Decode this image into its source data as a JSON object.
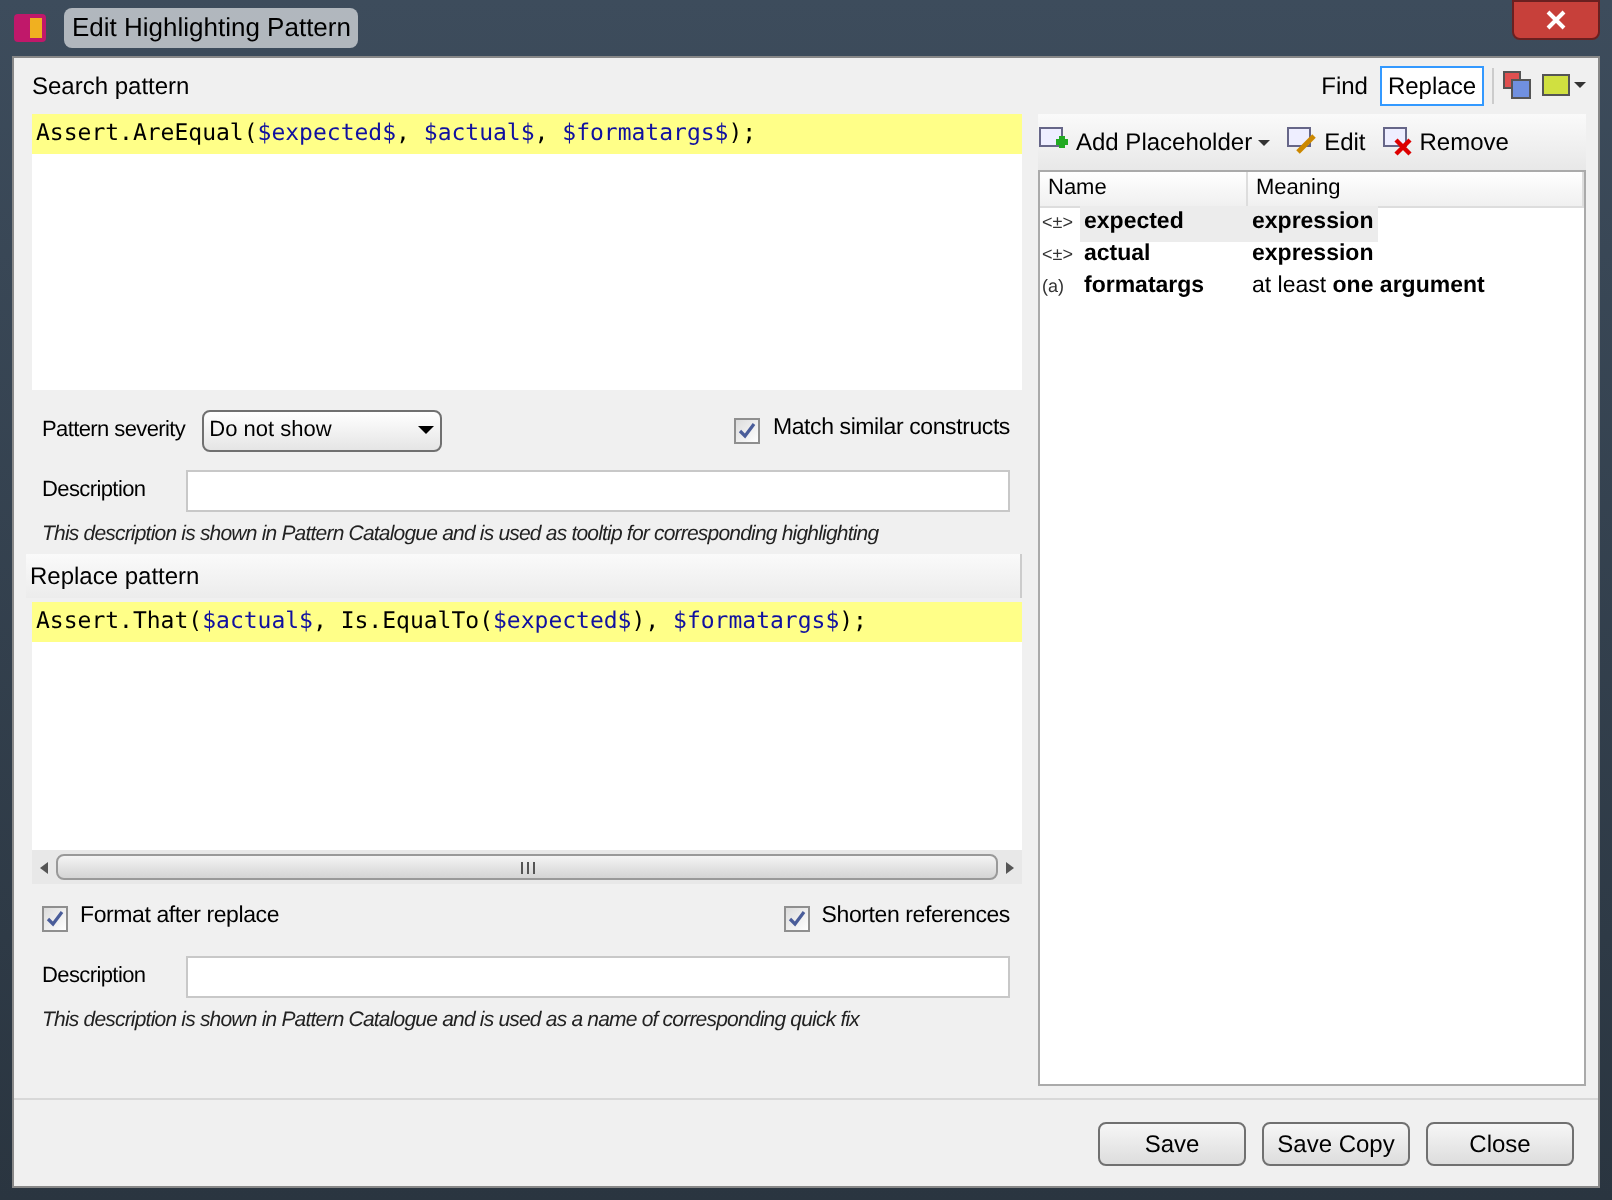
{
  "window": {
    "title": "Edit Highlighting Pattern"
  },
  "search": {
    "label": "Search pattern",
    "code": [
      {
        "kind": "text",
        "text": "Assert.AreEqual("
      },
      {
        "kind": "placeholder",
        "text": "$expected$"
      },
      {
        "kind": "text",
        "text": ", "
      },
      {
        "kind": "placeholder",
        "text": "$actual$"
      },
      {
        "kind": "text",
        "text": ", "
      },
      {
        "kind": "placeholder",
        "text": "$formatargs$"
      },
      {
        "kind": "text",
        "text": ");"
      }
    ],
    "severity_label": "Pattern severity",
    "severity": "Do not show",
    "match_similar": {
      "label": "Match similar constructs",
      "checked": true
    },
    "description_label": "Description",
    "hint": "This description is shown in Pattern Catalogue and is used as tooltip for corresponding highlighting"
  },
  "modes": [
    {
      "label": "Find",
      "selected": false
    },
    {
      "label": "Replace",
      "selected": true
    }
  ],
  "placeholder_toolbar": [
    {
      "kind": "add",
      "label": "Add Placeholder"
    },
    {
      "kind": "edit",
      "label": "Edit"
    },
    {
      "kind": "remove",
      "label": "Remove"
    }
  ],
  "placeholders": {
    "columns": [
      "Name",
      "Meaning"
    ],
    "rows": [
      {
        "icon": "<±>",
        "name": "expected",
        "meaning": "expression",
        "meaning_bold": true,
        "selected": true
      },
      {
        "icon": "<±>",
        "name": "actual",
        "meaning": "expression",
        "meaning_bold": true,
        "selected": false
      },
      {
        "icon": "(a)",
        "name": "formatargs",
        "meaning": "at least **one argument**",
        "meaning_bold": false,
        "selected": false
      }
    ]
  },
  "replace": {
    "label": "Replace pattern",
    "code": [
      {
        "kind": "text",
        "text": "Assert.That("
      },
      {
        "kind": "placeholder",
        "text": "$actual$"
      },
      {
        "kind": "text",
        "text": ", Is.EqualTo("
      },
      {
        "kind": "placeholder",
        "text": "$expected$"
      },
      {
        "kind": "text",
        "text": "), "
      },
      {
        "kind": "placeholder",
        "text": "$formatargs$"
      },
      {
        "kind": "text",
        "text": ");"
      }
    ],
    "format_after": {
      "label": "Format after replace",
      "checked": true
    },
    "shorten": {
      "label": "Shorten references",
      "checked": true
    },
    "description_label": "Description",
    "hint": "This description is shown in Pattern Catalogue and is used as a name of corresponding quick fix"
  },
  "buttons": [
    "Save",
    "Save Copy",
    "Close"
  ]
}
